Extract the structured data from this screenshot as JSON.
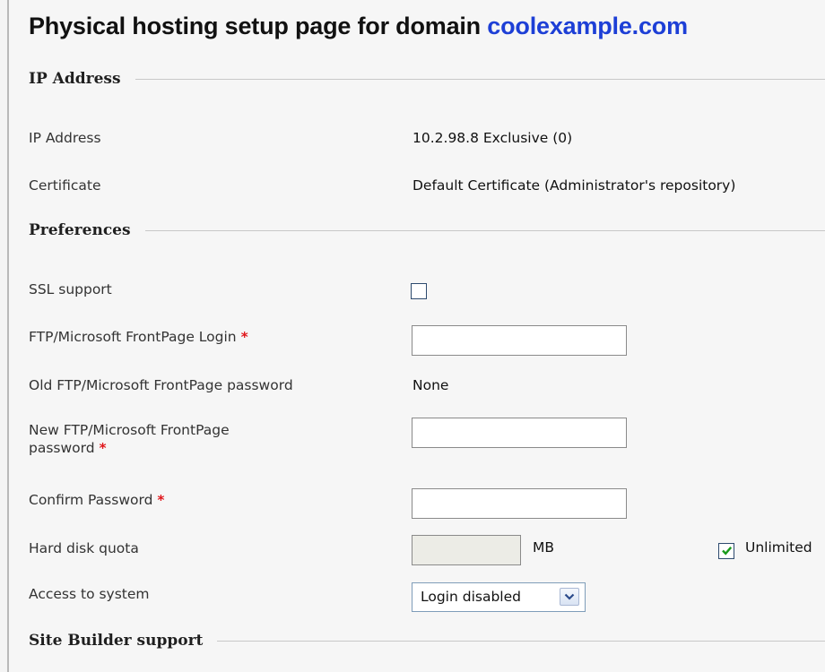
{
  "header": {
    "title_prefix": "Physical hosting setup page for domain",
    "domain": "coolexample.com"
  },
  "sections": {
    "ip": "IP Address",
    "preferences": "Preferences",
    "sitebuilder": "Site Builder support"
  },
  "ip_address": {
    "label": "IP Address",
    "value": "10.2.98.8 Exclusive (0)"
  },
  "certificate": {
    "label": "Certificate",
    "value": "Default Certificate (Administrator's repository)"
  },
  "ssl": {
    "label": "SSL support",
    "checked": false
  },
  "ftp_login": {
    "label": "FTP/Microsoft FrontPage Login",
    "required_mark": "*",
    "value": ""
  },
  "old_password": {
    "label": "Old FTP/Microsoft FrontPage password",
    "value": "None"
  },
  "new_password": {
    "label_line1": "New FTP/Microsoft FrontPage",
    "label_line2": "password",
    "required_mark": "*",
    "value": ""
  },
  "confirm_password": {
    "label": "Confirm Password",
    "required_mark": "*",
    "value": ""
  },
  "quota": {
    "label": "Hard disk quota",
    "value": "",
    "unit": "MB",
    "unlimited_label": "Unlimited",
    "unlimited_checked": true
  },
  "access": {
    "label": "Access to system",
    "selected": "Login disabled"
  },
  "icons": {
    "checkmark": "checkmark-icon",
    "dropdown": "chevron-down-icon"
  },
  "colors": {
    "domain_link": "#1d3fd6",
    "required": "#e0161b",
    "checkmark": "#1a9a1a"
  }
}
